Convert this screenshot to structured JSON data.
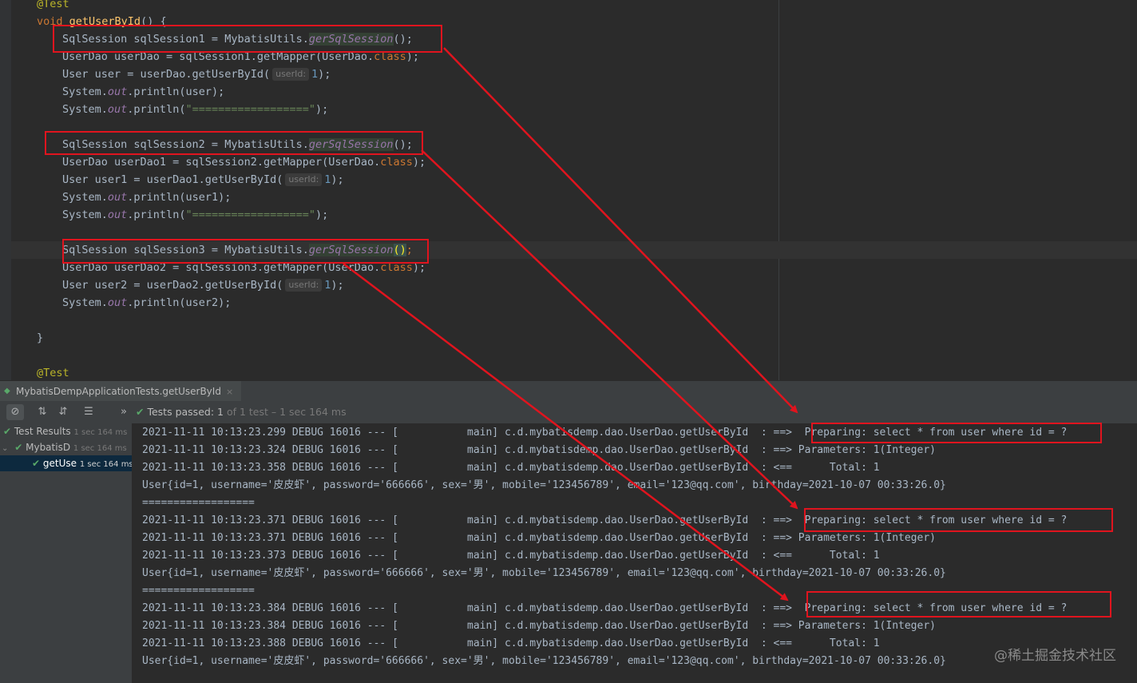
{
  "editor": {
    "lines": {
      "l0": "@Test",
      "l1_kw": "void",
      "l1_fn": "getUserById",
      "l1_rest": "() {",
      "l2_a": "SqlSession sqlSession1 = MybatisUtils.",
      "l2_m": "gerSqlSession",
      "l2_b": "();",
      "l3_a": "UserDao userDao = sqlSession1.getMapper(UserDao.",
      "l3_kw": "class",
      "l3_b": ");",
      "l4_a": "User user = userDao.getUserById(",
      "l4_hint": "userId:",
      "l4_num": "1",
      "l4_b": ");",
      "l5_a": "System.",
      "l5_st": "out",
      "l5_b": ".println(user);",
      "l6_a": "System.",
      "l6_st": "out",
      "l6_b": ".println(",
      "l6_str": "\"==================\"",
      "l6_c": ");",
      "l8_a": "SqlSession sqlSession2 = MybatisUtils.",
      "l8_m": "gerSqlSession",
      "l8_b": "();",
      "l9_a": "UserDao userDao1 = sqlSession2.getMapper(UserDao.",
      "l9_kw": "class",
      "l9_b": ");",
      "l10_a": "User user1 = userDao1.getUserById(",
      "l10_hint": "userId:",
      "l10_num": "1",
      "l10_b": ");",
      "l11_a": "System.",
      "l11_st": "out",
      "l11_b": ".println(user1);",
      "l12_a": "System.",
      "l12_st": "out",
      "l12_b": ".println(",
      "l12_str": "\"==================\"",
      "l12_c": ");",
      "l14_a": "SqlSession sqlSession3 = MybatisUtils.",
      "l14_m": "gerSqlSession",
      "l14_br": "()",
      "l14_b": ";",
      "l15_a": "UserDao userDao2 = sqlSession3.getMapper(UserDao.",
      "l15_kw": "class",
      "l15_b": ");",
      "l16_a": "User user2 = userDao2.getUserById(",
      "l16_hint": "userId:",
      "l16_num": "1",
      "l16_b": ");",
      "l17_a": "System.",
      "l17_st": "out",
      "l17_b": ".println(user2);",
      "l19": "}",
      "l21": "@Test"
    }
  },
  "run_tab": {
    "label": "MybatisDempApplicationTests.getUserById",
    "close": "×"
  },
  "toolbar": {
    "status_label": "Tests passed:",
    "status_count": "1",
    "status_rest": "of 1 test – 1 sec 164 ms",
    "more": "»"
  },
  "tree": {
    "root_label": "Test Results",
    "root_time": "1 sec 164 ms",
    "class_label": "MybatisD",
    "class_time": "1 sec 164 ms",
    "method_label": "getUse",
    "method_time": "1 sec 164 ms"
  },
  "console": {
    "lines": [
      "2021-11-11 10:13:23.299 DEBUG 16016 --- [           main] c.d.mybatisdemp.dao.UserDao.getUserById  : ==>  Preparing: select * from user where id = ?",
      "2021-11-11 10:13:23.324 DEBUG 16016 --- [           main] c.d.mybatisdemp.dao.UserDao.getUserById  : ==> Parameters: 1(Integer)",
      "2021-11-11 10:13:23.358 DEBUG 16016 --- [           main] c.d.mybatisdemp.dao.UserDao.getUserById  : <==      Total: 1",
      "User{id=1, username='皮皮虾', password='666666', sex='男', mobile='123456789', email='123@qq.com', birthday=2021-10-07 00:33:26.0}",
      "==================",
      "2021-11-11 10:13:23.371 DEBUG 16016 --- [           main] c.d.mybatisdemp.dao.UserDao.getUserById  : ==>  Preparing: select * from user where id = ?",
      "2021-11-11 10:13:23.371 DEBUG 16016 --- [           main] c.d.mybatisdemp.dao.UserDao.getUserById  : ==> Parameters: 1(Integer)",
      "2021-11-11 10:13:23.373 DEBUG 16016 --- [           main] c.d.mybatisdemp.dao.UserDao.getUserById  : <==      Total: 1",
      "User{id=1, username='皮皮虾', password='666666', sex='男', mobile='123456789', email='123@qq.com', birthday=2021-10-07 00:33:26.0}",
      "==================",
      "2021-11-11 10:13:23.384 DEBUG 16016 --- [           main] c.d.mybatisdemp.dao.UserDao.getUserById  : ==>  Preparing: select * from user where id = ?",
      "2021-11-11 10:13:23.384 DEBUG 16016 --- [           main] c.d.mybatisdemp.dao.UserDao.getUserById  : ==> Parameters: 1(Integer)",
      "2021-11-11 10:13:23.388 DEBUG 16016 --- [           main] c.d.mybatisdemp.dao.UserDao.getUserById  : <==      Total: 1",
      "User{id=1, username='皮皮虾', password='666666', sex='男', mobile='123456789', email='123@qq.com', birthday=2021-10-07 00:33:26.0}"
    ]
  },
  "watermark": "@稀土掘金技术社区",
  "colors": {
    "annotation_red": "#e0141e",
    "pass_green": "#59a869"
  }
}
